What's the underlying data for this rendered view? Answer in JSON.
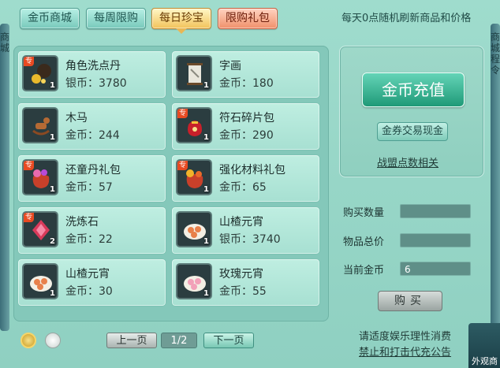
{
  "tabs": [
    {
      "label": "金币商城"
    },
    {
      "label": "每周限购"
    },
    {
      "label": "每日珍宝"
    },
    {
      "label": "限购礼包"
    }
  ],
  "notice": "每天0点随机刷新商品和价格",
  "items": [
    {
      "name": "角色洗点丹",
      "price": "银币：3780",
      "qty": "1",
      "tag": "专"
    },
    {
      "name": "字画",
      "price": "金币：180",
      "qty": "1",
      "tag": ""
    },
    {
      "name": "木马",
      "price": "金币：244",
      "qty": "1",
      "tag": ""
    },
    {
      "name": "符石碎片包",
      "price": "金币：290",
      "qty": "1",
      "tag": "专"
    },
    {
      "name": "还童丹礼包",
      "price": "金币：57",
      "qty": "1",
      "tag": "专"
    },
    {
      "name": "强化材料礼包",
      "price": "金币：65",
      "qty": "1",
      "tag": "专"
    },
    {
      "name": "洗炼石",
      "price": "金币：22",
      "qty": "2",
      "tag": "专"
    },
    {
      "name": "山楂元宵",
      "price": "银币：3740",
      "qty": "1",
      "tag": ""
    },
    {
      "name": "山楂元宵",
      "price": "金币：30",
      "qty": "1",
      "tag": ""
    },
    {
      "name": "玫瑰元宵",
      "price": "金币：55",
      "qty": "1",
      "tag": ""
    }
  ],
  "recharge_label": "金币充值",
  "voucher_label": "金券交易现金",
  "alliance_label": "战盟点数相关",
  "form": {
    "qty_label": "购买数量",
    "total_label": "物品总价",
    "gold_label": "当前金币",
    "qty_value": "",
    "total_value": "",
    "gold_value": "6"
  },
  "buy_label": "购买",
  "pager": {
    "prev": "上一页",
    "page": "1/2",
    "next": "下一页"
  },
  "footer": {
    "line1": "请适度娱乐理性消费",
    "line2": "禁止和打击代充公告"
  },
  "corner_label": "外观商",
  "edge_right_text": "商城 程令",
  "edge_left_text": "商城",
  "colors": {
    "accent": "#1f9a78",
    "active_tab": "#f2c35a",
    "limited_tab": "#f0906a"
  }
}
